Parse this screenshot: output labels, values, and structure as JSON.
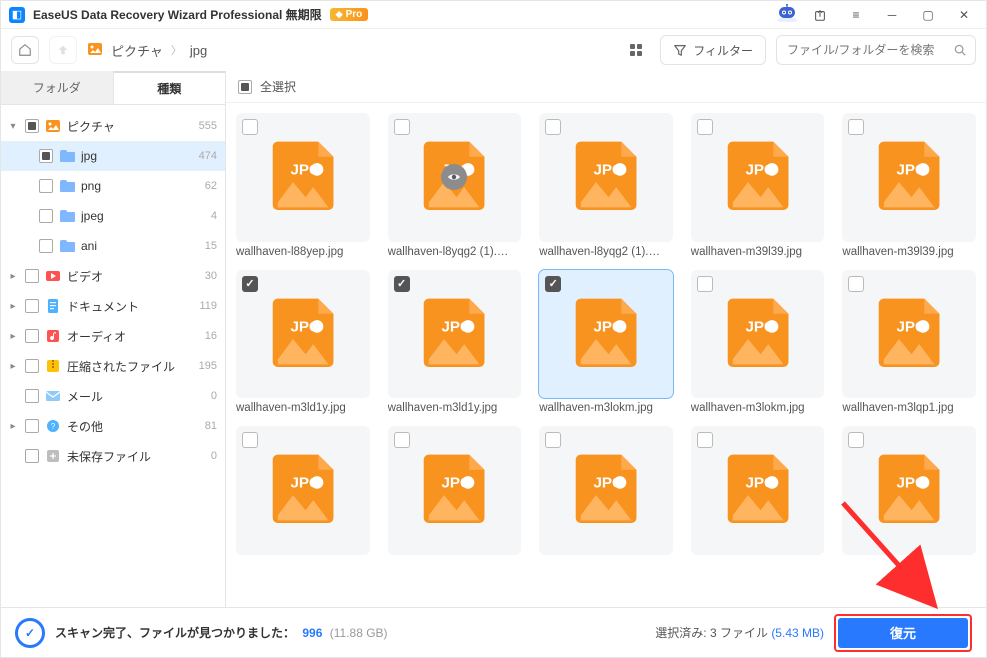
{
  "titlebar": {
    "app_name": "EaseUS Data Recovery Wizard Professional 無期限",
    "pro_badge": "Pro"
  },
  "toolbar": {
    "breadcrumb": [
      "ピクチャ",
      "jpg"
    ],
    "filter_label": "フィルター",
    "search_placeholder": "ファイル/フォルダーを検索"
  },
  "sidebar": {
    "tabs": {
      "folder": "フォルダ",
      "type": "種類"
    },
    "tree": [
      {
        "id": "pictures",
        "label": "ピクチャ",
        "count": 555,
        "icon": "pic",
        "expanded": true,
        "cb": "indeterminate",
        "children": [
          {
            "id": "jpg",
            "label": "jpg",
            "count": 474,
            "icon": "folder",
            "cb": "indeterminate",
            "selected": true
          },
          {
            "id": "png",
            "label": "png",
            "count": 62,
            "icon": "folder",
            "cb": "empty"
          },
          {
            "id": "jpeg",
            "label": "jpeg",
            "count": 4,
            "icon": "folder",
            "cb": "empty"
          },
          {
            "id": "ani",
            "label": "ani",
            "count": 15,
            "icon": "folder",
            "cb": "empty"
          }
        ]
      },
      {
        "id": "videos",
        "label": "ビデオ",
        "count": 30,
        "icon": "vid",
        "cb": "empty",
        "collapsed": true
      },
      {
        "id": "documents",
        "label": "ドキュメント",
        "count": 119,
        "icon": "doc",
        "cb": "empty",
        "collapsed": true
      },
      {
        "id": "audio",
        "label": "オーディオ",
        "count": 16,
        "icon": "audio",
        "cb": "empty",
        "collapsed": true
      },
      {
        "id": "archives",
        "label": "圧縮されたファイル",
        "count": 195,
        "icon": "zip",
        "cb": "empty",
        "collapsed": true
      },
      {
        "id": "mail",
        "label": "メール",
        "count": 0,
        "icon": "mail",
        "cb": "empty"
      },
      {
        "id": "other",
        "label": "その他",
        "count": 81,
        "icon": "other",
        "cb": "empty",
        "collapsed": true
      },
      {
        "id": "unsaved",
        "label": "未保存ファイル",
        "count": 0,
        "icon": "unsaved",
        "cb": "empty"
      }
    ]
  },
  "content": {
    "select_all_label": "全選択",
    "select_all_cb": "indeterminate",
    "files": [
      {
        "name": "wallhaven-l88yep.jpg",
        "checked": false
      },
      {
        "name": "wallhaven-l8yqg2 (1).…",
        "checked": false,
        "preview": true
      },
      {
        "name": "wallhaven-l8yqg2 (1).…",
        "checked": false
      },
      {
        "name": "wallhaven-m39l39.jpg",
        "checked": false
      },
      {
        "name": "wallhaven-m39l39.jpg",
        "checked": false
      },
      {
        "name": "wallhaven-m3ld1y.jpg",
        "checked": true
      },
      {
        "name": "wallhaven-m3ld1y.jpg",
        "checked": true
      },
      {
        "name": "wallhaven-m3lokm.jpg",
        "checked": true,
        "selected": true
      },
      {
        "name": "wallhaven-m3lokm.jpg",
        "checked": false
      },
      {
        "name": "wallhaven-m3lqp1.jpg",
        "checked": false
      },
      {
        "name": "",
        "checked": false
      },
      {
        "name": "",
        "checked": false
      },
      {
        "name": "",
        "checked": false
      },
      {
        "name": "",
        "checked": false
      },
      {
        "name": "",
        "checked": false
      }
    ]
  },
  "footer": {
    "scan_done_label": "スキャン完了、ファイルが見つかりました：",
    "found_count": "996",
    "found_size": "(11.88 GB)",
    "selected_label_prefix": "選択済み:",
    "selected_count": "3 ファイル",
    "selected_size": "(5.43 MB)",
    "recover_button": "復元"
  }
}
